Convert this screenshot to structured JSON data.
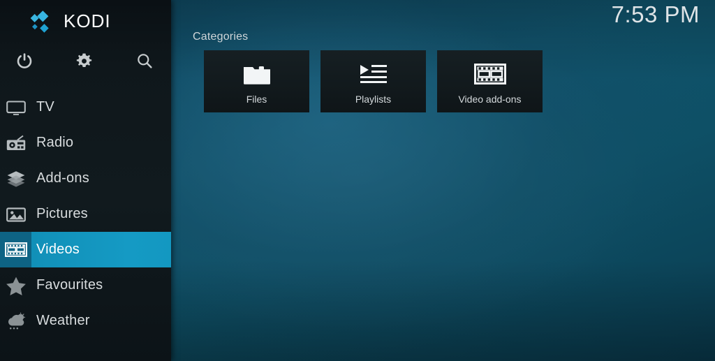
{
  "app": {
    "brand": "KODI",
    "logo_icon": "kodi-logo-icon"
  },
  "clock": {
    "time": "7:53 PM"
  },
  "quick_actions": [
    {
      "name": "power-icon",
      "label": "Power"
    },
    {
      "name": "gear-icon",
      "label": "Settings"
    },
    {
      "name": "search-icon",
      "label": "Search"
    }
  ],
  "sidebar": {
    "items": [
      {
        "label": "TV",
        "icon": "tv-icon",
        "active": false
      },
      {
        "label": "Radio",
        "icon": "radio-icon",
        "active": false
      },
      {
        "label": "Add-ons",
        "icon": "addons-box-icon",
        "active": false
      },
      {
        "label": "Pictures",
        "icon": "pictures-icon",
        "active": false
      },
      {
        "label": "Videos",
        "icon": "film-strip-icon",
        "active": true
      },
      {
        "label": "Favourites",
        "icon": "star-icon",
        "active": false
      },
      {
        "label": "Weather",
        "icon": "weather-icon",
        "active": false
      }
    ]
  },
  "content": {
    "section_label": "Categories",
    "tiles": [
      {
        "label": "Files",
        "icon": "folder-icon"
      },
      {
        "label": "Playlists",
        "icon": "playlist-icon"
      },
      {
        "label": "Video add-ons",
        "icon": "film-strip-icon"
      }
    ]
  },
  "colors": {
    "accent": "#1398c1",
    "accent_dark": "#0e6384",
    "sidebar_bg": "#111a1e",
    "tile_bg": "#121a1d",
    "background": "#0e5066",
    "brand_blue": "#2bb2e0",
    "text": "#d8dcde"
  }
}
